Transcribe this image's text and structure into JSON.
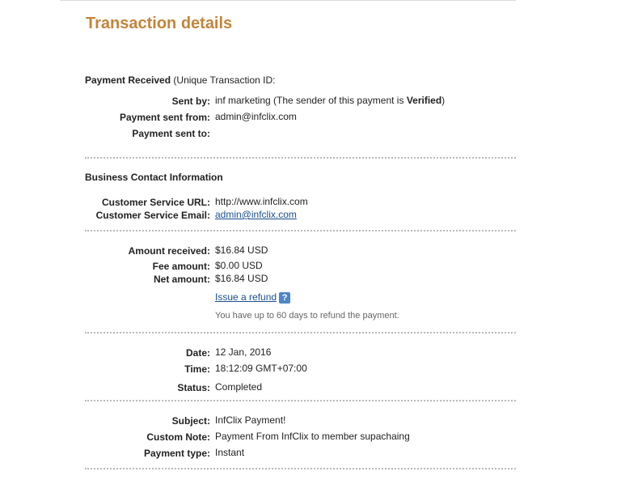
{
  "page": {
    "title": "Transaction details"
  },
  "payment": {
    "heading": "Payment Received",
    "heading_suffix": "(Unique Transaction ID:",
    "sent_by_label": "Sent by:",
    "sent_by_value": "inf marketing",
    "sent_by_note_prefix": "(The sender of this payment is",
    "sent_by_status": "Verified",
    "sent_by_note_suffix": ")",
    "sent_from_label": "Payment sent from:",
    "sent_from_value": "admin@infclix.com",
    "sent_to_label": "Payment sent to:",
    "sent_to_value": ""
  },
  "business": {
    "heading": "Business Contact Information",
    "url_label": "Customer Service URL:",
    "url_value": "http://www.infclix.com",
    "email_label": "Customer Service Email:",
    "email_value": "admin@infclix.com"
  },
  "amounts": {
    "received_label": "Amount received:",
    "received_value": "$16.84 USD",
    "fee_label": "Fee amount:",
    "fee_value": "$0.00 USD",
    "net_label": "Net amount:",
    "net_value": "$16.84 USD",
    "refund_link": "Issue a refund",
    "help_glyph": "?",
    "refund_note": "You have up to 60 days to refund the payment."
  },
  "timing": {
    "date_label": "Date:",
    "date_value": "12 Jan, 2016",
    "time_label": "Time:",
    "time_value": "18:12:09 GMT+07:00",
    "status_label": "Status:",
    "status_value": "Completed"
  },
  "details": {
    "subject_label": "Subject:",
    "subject_value": "InfClix Payment!",
    "note_label": "Custom Note:",
    "note_value": "Payment From InfClix to member supachaing",
    "type_label": "Payment type:",
    "type_value": "Instant"
  }
}
